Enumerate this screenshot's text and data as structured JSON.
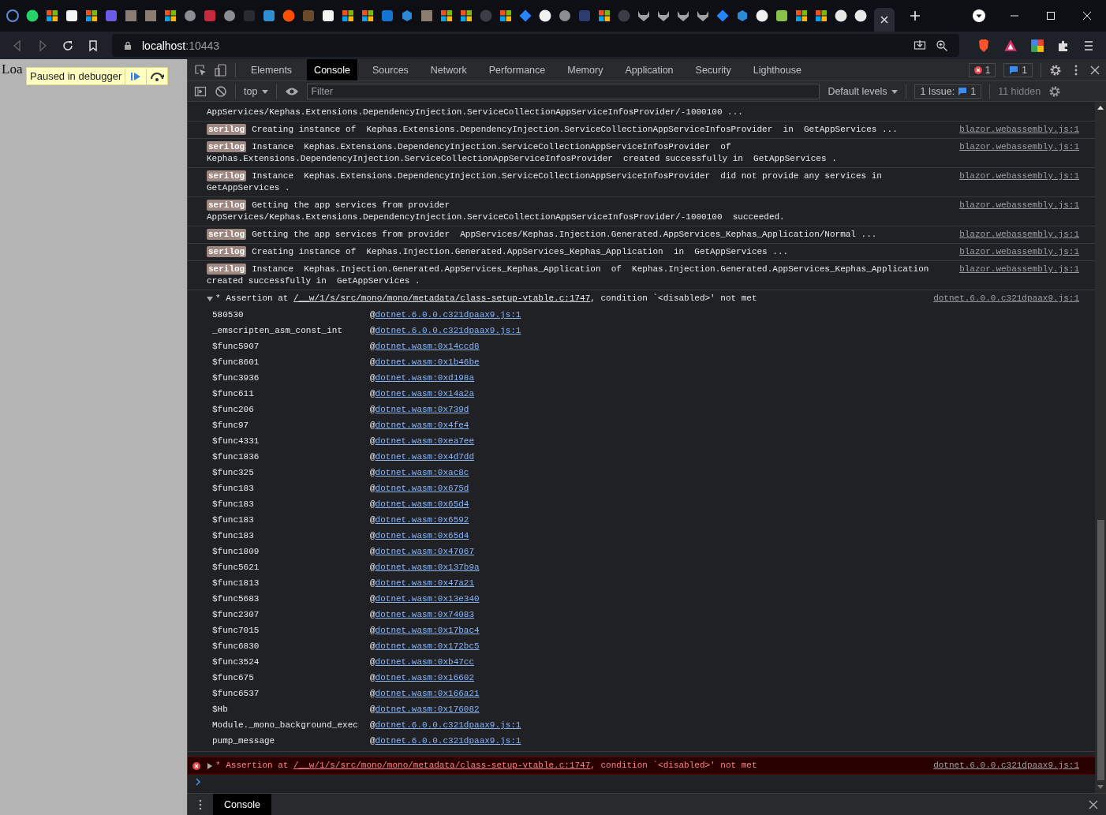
{
  "browser": {
    "address": {
      "host": "localhost",
      "port": ":10443"
    }
  },
  "page": {
    "text": "Loa",
    "overlay": {
      "label": "Paused in debugger"
    }
  },
  "devtools": {
    "tabs": [
      {
        "label": "Elements",
        "selected": false
      },
      {
        "label": "Console",
        "selected": true
      },
      {
        "label": "Sources",
        "selected": false
      },
      {
        "label": "Network",
        "selected": false
      },
      {
        "label": "Performance",
        "selected": false
      },
      {
        "label": "Memory",
        "selected": false
      },
      {
        "label": "Application",
        "selected": false
      },
      {
        "label": "Security",
        "selected": false
      },
      {
        "label": "Lighthouse",
        "selected": false
      }
    ],
    "error_count": "1",
    "message_count": "1",
    "console_toolbar": {
      "context": "top",
      "filter_placeholder": "Filter",
      "levels": "Default levels",
      "issues_label": "1 Issue:",
      "issues_count": "1",
      "hidden": "11 hidden"
    },
    "messages": [
      {
        "kind": "log",
        "lines": [
          "AppServices/Kephas.Extensions.DependencyInjection.ServiceCollectionAppServiceInfosProvider/-1000100 ..."
        ]
      },
      {
        "kind": "log",
        "badge": "serilog",
        "lines": [
          "Creating instance of  Kephas.Extensions.DependencyInjection.ServiceCollectionAppServiceInfosProvider  in  GetAppServices ..."
        ],
        "source": "blazor.webassembly.js:1"
      },
      {
        "kind": "log",
        "badge": "serilog",
        "lines": [
          "Instance  Kephas.Extensions.DependencyInjection.ServiceCollectionAppServiceInfosProvider  of",
          "Kephas.Extensions.DependencyInjection.ServiceCollectionAppServiceInfosProvider  created successfully in  GetAppServices ."
        ],
        "source": "blazor.webassembly.js:1"
      },
      {
        "kind": "log",
        "badge": "serilog",
        "lines": [
          "Instance  Kephas.Extensions.DependencyInjection.ServiceCollectionAppServiceInfosProvider  did not provide any services in",
          "GetAppServices ."
        ],
        "source": "blazor.webassembly.js:1"
      },
      {
        "kind": "log",
        "badge": "serilog",
        "lines": [
          "Getting the app services from provider",
          "AppServices/Kephas.Extensions.DependencyInjection.ServiceCollectionAppServiceInfosProvider/-1000100  succeeded."
        ],
        "source": "blazor.webassembly.js:1"
      },
      {
        "kind": "log",
        "badge": "serilog",
        "lines": [
          "Getting the app services from provider  AppServices/Kephas.Injection.Generated.AppServices_Kephas_Application/Normal ..."
        ],
        "source": "blazor.webassembly.js:1"
      },
      {
        "kind": "log",
        "badge": "serilog",
        "lines": [
          "Creating instance of  Kephas.Injection.Generated.AppServices_Kephas_Application  in  GetAppServices ..."
        ],
        "source": "blazor.webassembly.js:1"
      },
      {
        "kind": "log",
        "badge": "serilog",
        "lines": [
          "Instance  Kephas.Injection.Generated.AppServices_Kephas_Application  of  Kephas.Injection.Generated.AppServices_Kephas_Application",
          "created successfully in  GetAppServices ."
        ],
        "source": "blazor.webassembly.js:1"
      },
      {
        "kind": "assertion",
        "error": false,
        "expanded": true,
        "prefix": "* Assertion at ",
        "path": "/__w/1/s/src/mono/mono/metadata/class-setup-vtable.c:1747",
        "suffix": ", condition `<disabled>' not met",
        "source": "dotnet.6.0.0.c321dpaax9.js:1",
        "frames": [
          {
            "fn": "580530",
            "at": "@",
            "location": "dotnet.6.0.0.c321dpaax9.js:1"
          },
          {
            "fn": "_emscripten_asm_const_int",
            "at": "@",
            "location": "dotnet.6.0.0.c321dpaax9.js:1"
          },
          {
            "fn": "$func5907",
            "at": "@",
            "location": "dotnet.wasm:0x14ccd8"
          },
          {
            "fn": "$func8601",
            "at": "@",
            "location": "dotnet.wasm:0x1b46be"
          },
          {
            "fn": "$func3936",
            "at": "@",
            "location": "dotnet.wasm:0xd198a"
          },
          {
            "fn": "$func611",
            "at": "@",
            "location": "dotnet.wasm:0x14a2a"
          },
          {
            "fn": "$func206",
            "at": "@",
            "location": "dotnet.wasm:0x739d"
          },
          {
            "fn": "$func97",
            "at": "@",
            "location": "dotnet.wasm:0x4fe4"
          },
          {
            "fn": "$func4331",
            "at": "@",
            "location": "dotnet.wasm:0xea7ee"
          },
          {
            "fn": "$func1836",
            "at": "@",
            "location": "dotnet.wasm:0x4d7dd"
          },
          {
            "fn": "$func325",
            "at": "@",
            "location": "dotnet.wasm:0xac8c"
          },
          {
            "fn": "$func183",
            "at": "@",
            "location": "dotnet.wasm:0x675d"
          },
          {
            "fn": "$func183",
            "at": "@",
            "location": "dotnet.wasm:0x65d4"
          },
          {
            "fn": "$func183",
            "at": "@",
            "location": "dotnet.wasm:0x6592"
          },
          {
            "fn": "$func183",
            "at": "@",
            "location": "dotnet.wasm:0x65d4"
          },
          {
            "fn": "$func1809",
            "at": "@",
            "location": "dotnet.wasm:0x47067"
          },
          {
            "fn": "$func5621",
            "at": "@",
            "location": "dotnet.wasm:0x137b9a"
          },
          {
            "fn": "$func1813",
            "at": "@",
            "location": "dotnet.wasm:0x47a21"
          },
          {
            "fn": "$func5683",
            "at": "@",
            "location": "dotnet.wasm:0x13e340"
          },
          {
            "fn": "$func2307",
            "at": "@",
            "location": "dotnet.wasm:0x74083"
          },
          {
            "fn": "$func7015",
            "at": "@",
            "location": "dotnet.wasm:0x17bac4"
          },
          {
            "fn": "$func6830",
            "at": "@",
            "location": "dotnet.wasm:0x172bc5"
          },
          {
            "fn": "$func3524",
            "at": "@",
            "location": "dotnet.wasm:0xb47cc"
          },
          {
            "fn": "$func675",
            "at": "@",
            "location": "dotnet.wasm:0x16602"
          },
          {
            "fn": "$func6537",
            "at": "@",
            "location": "dotnet.wasm:0x166a21"
          },
          {
            "fn": "$Hb",
            "at": "@",
            "location": "dotnet.wasm:0x176082"
          },
          {
            "fn": "Module._mono_background_exec",
            "at": "@",
            "location": "dotnet.6.0.0.c321dpaax9.js:1"
          },
          {
            "fn": "pump_message",
            "at": "@",
            "location": "dotnet.6.0.0.c321dpaax9.js:1"
          }
        ]
      },
      {
        "kind": "assertion",
        "error": true,
        "expanded": false,
        "prefix": "* Assertion at ",
        "path": "/__w/1/s/src/mono/mono/metadata/class-setup-vtable.c:1747",
        "suffix": ", condition `<disabled>' not met",
        "source": "dotnet.6.0.0.c321dpaax9.js:1"
      }
    ],
    "drawer": {
      "tab": "Console"
    }
  }
}
